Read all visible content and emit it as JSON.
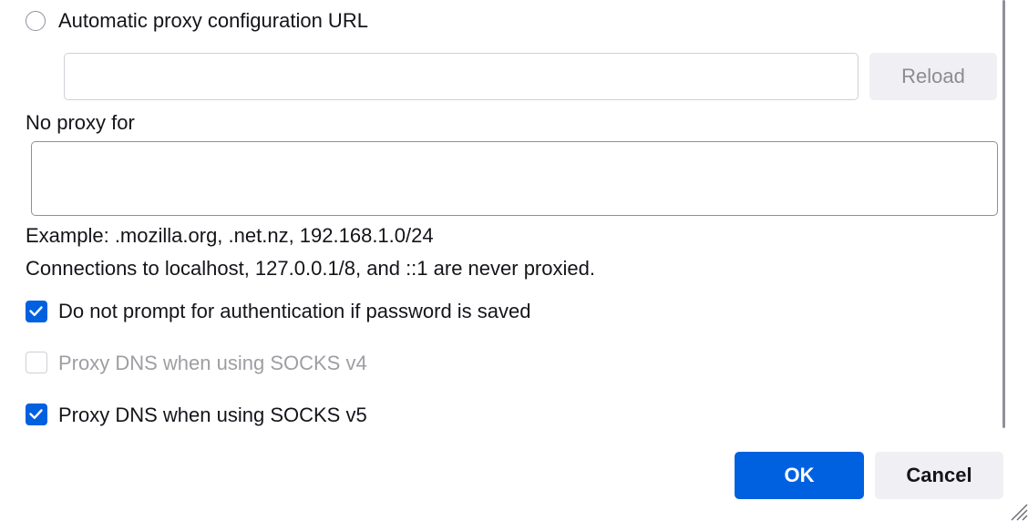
{
  "auto_proxy": {
    "radio_label": "Automatic proxy configuration URL",
    "url_value": "",
    "reload_label": "Reload"
  },
  "no_proxy": {
    "label": "No proxy for",
    "value": "",
    "example_text": "Example: .mozilla.org, .net.nz, 192.168.1.0/24",
    "note_text": "Connections to localhost, 127.0.0.1/8, and ::1 are never proxied."
  },
  "options": [
    {
      "label": "Do not prompt for authentication if password is saved",
      "checked": true,
      "disabled": false
    },
    {
      "label": "Proxy DNS when using SOCKS v4",
      "checked": false,
      "disabled": true
    },
    {
      "label": "Proxy DNS when using SOCKS v5",
      "checked": true,
      "disabled": false
    }
  ],
  "footer": {
    "ok_label": "OK",
    "cancel_label": "Cancel"
  },
  "colors": {
    "accent": "#0061e0",
    "button_gray": "#f0f0f4",
    "text": "#15141a",
    "disabled_text": "#9e9ea3"
  }
}
